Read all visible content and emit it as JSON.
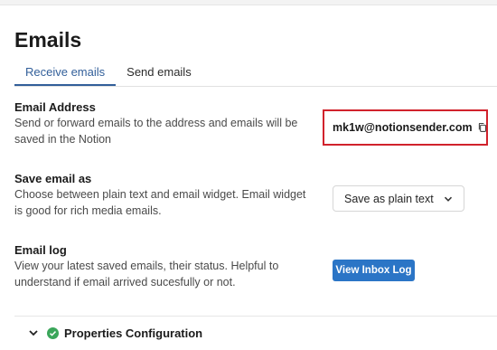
{
  "page": {
    "title": "Emails"
  },
  "tabs": [
    {
      "label": "Receive emails",
      "active": true
    },
    {
      "label": "Send emails",
      "active": false
    }
  ],
  "email_address": {
    "label": "Email Address",
    "description": "Send or forward emails to the address and emails will be saved in the Notion",
    "address": "mk1w@notionsender.com",
    "copy_icon": "copy-icon",
    "highlight_color": "#d1222c"
  },
  "save_as": {
    "label": "Save email as",
    "description": "Choose between plain text and email widget. Email widget is good for rich media emails.",
    "selected": "Save as plain text"
  },
  "email_log": {
    "label": "Email log",
    "description": "View your latest saved emails, their status. Helpful to understand if email arrived sucesfully or not.",
    "button_label": "View Inbox Log",
    "button_color": "#2b75c6"
  },
  "properties": {
    "label": "Properties Configuration",
    "status_icon": "check-circle-icon",
    "status_color": "#3aa65a"
  }
}
